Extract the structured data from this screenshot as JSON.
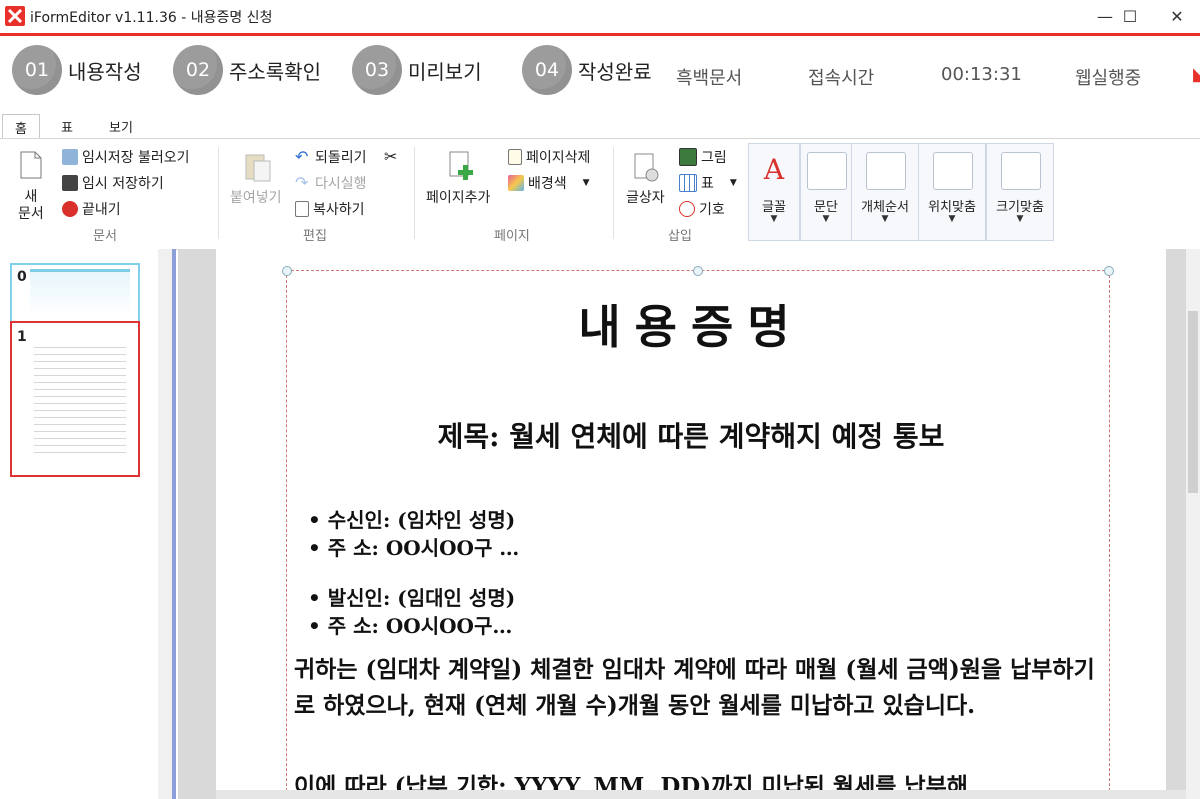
{
  "window": {
    "title": "iFormEditor v1.11.36 - 내용증명 신청",
    "minimize": "—",
    "maximize": "☐",
    "close": "✕"
  },
  "steps": [
    {
      "num": "01",
      "label": "내용작성"
    },
    {
      "num": "02",
      "label": "주소록확인"
    },
    {
      "num": "03",
      "label": "미리보기"
    },
    {
      "num": "04",
      "label": "작성완료"
    }
  ],
  "status": {
    "mono": "흑백문서",
    "access_label": "접속시간",
    "access_time": "00:13:31",
    "web_run": "웹실행중"
  },
  "tabs": [
    "홈",
    "표",
    "보기"
  ],
  "ribbon": {
    "doc": {
      "new_line1": "새",
      "new_line2": "문서",
      "load_temp": "임시저장 불러오기",
      "save_temp": "임시 저장하기",
      "exit": "끝내기",
      "group": "문서"
    },
    "edit": {
      "paste": "붙여넣기",
      "undo": "되돌리기",
      "redo": "다시실행",
      "copy": "복사하기",
      "group": "편집"
    },
    "page": {
      "add": "페이지추가",
      "delete": "페이지삭제",
      "bg": "배경색",
      "group": "페이지"
    },
    "insert": {
      "textbox": "글상자",
      "image": "그림",
      "table": "표",
      "symbol": "기호",
      "group": "삽입"
    },
    "format": [
      "글꼴",
      "문단",
      "개체순서",
      "위치맞춤",
      "크기맞춤"
    ]
  },
  "thumbnails": [
    "0",
    "1"
  ],
  "document": {
    "title": "내용증명",
    "subtitle": "제목: 월세 연체에 따른 계약해지 예정 통보",
    "recipient_name": "• 수신인: (임차인 성명)",
    "recipient_addr": "• 주   소: OO시OO구 …",
    "sender_name": "• 발신인: (임대인 성명)",
    "sender_addr": "• 주   소: OO시OO구…",
    "paragraph1": "귀하는 (임대차 계약일) 체결한 임대차 계약에 따라 매월 (월세 금액)원을 납부하기로 하였으나, 현재 (연체 개월 수)개월 동안 월세를 미납하고 있습니다.",
    "paragraph2": "이에 따라 (납부 기한: YYYY. MM. DD)까지 미납된 월세를 납부해"
  },
  "colors": {
    "accent": "#e8312b",
    "step_circle": "#9c9c9c",
    "splitter": "#8e9ed8"
  }
}
